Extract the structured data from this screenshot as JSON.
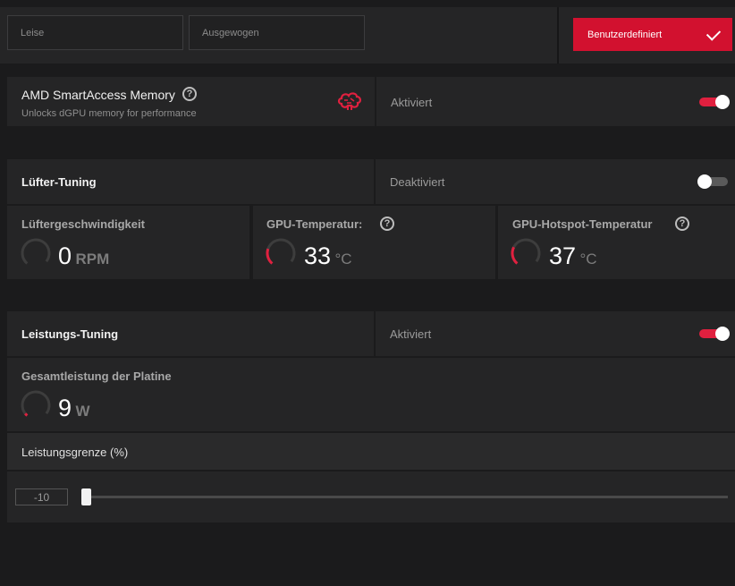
{
  "presets": {
    "items": [
      {
        "label": "Leise"
      },
      {
        "label": "Ausgewogen"
      }
    ],
    "active_label": "Benutzerdefiniert"
  },
  "smart_access": {
    "title": "AMD SmartAccess Memory",
    "subtitle": "Unlocks dGPU memory for performance",
    "state": "Aktiviert",
    "enabled": true,
    "icon": "brain-icon"
  },
  "fan_tuning": {
    "title": "Lüfter-Tuning",
    "state": "Deaktiviert",
    "enabled": false,
    "metrics": [
      {
        "label": "Lüftergeschwindigkeit",
        "value": "0",
        "unit": "RPM",
        "has_help": false
      },
      {
        "label": "GPU-Temperatur:",
        "value": "33",
        "unit": "°C",
        "has_help": true
      },
      {
        "label": "GPU-Hotspot-Temperatur",
        "value": "37",
        "unit": "°C",
        "has_help": true
      }
    ]
  },
  "power_tuning": {
    "title": "Leistungs-Tuning",
    "state": "Aktiviert",
    "enabled": true,
    "board_power": {
      "label": "Gesamtleistung der Platine",
      "value": "9",
      "unit": "W"
    },
    "power_limit": {
      "label": "Leistungsgrenze (%)",
      "value": "-10"
    }
  },
  "colors": {
    "accent": "#d2112f",
    "panel": "#252526",
    "background": "#1b1b1c"
  }
}
